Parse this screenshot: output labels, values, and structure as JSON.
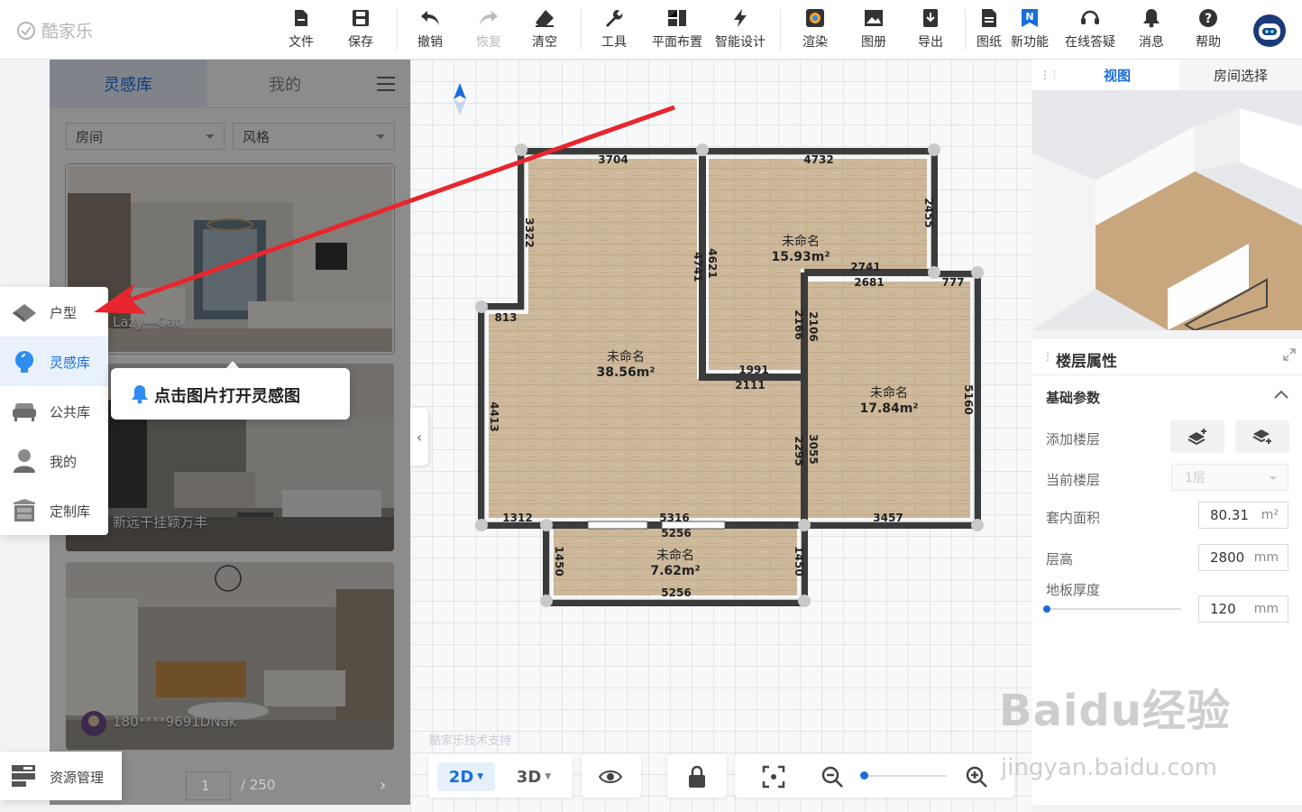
{
  "app": {
    "logo_text": "酷家乐"
  },
  "toolbar": {
    "file": "文件",
    "save": "保存",
    "undo": "撤销",
    "redo": "恢复",
    "clear": "清空",
    "tools": "工具",
    "layout": "平面布置",
    "smart": "智能设计",
    "render": "渲染",
    "album": "图册",
    "export": "导出",
    "drawings": "图纸",
    "new_feature": "新功能",
    "support": "在线答疑",
    "messages": "消息",
    "help": "帮助"
  },
  "catalog": {
    "tabs": [
      "灵感库",
      "我的"
    ],
    "filters": [
      "房间",
      "风格"
    ],
    "cards": [
      {
        "author": "Lazy—Cat"
      },
      {
        "author": "新远干挂颖万丰"
      },
      {
        "author": "180****9691DNak"
      }
    ],
    "pager": {
      "current": "1",
      "total": "/ 250"
    }
  },
  "leftnav": {
    "items": [
      "户型",
      "灵感库",
      "公共库",
      "我的",
      "定制库"
    ],
    "resource": "资源管理"
  },
  "tooltip": {
    "text": "点击图片打开灵感图"
  },
  "floorplan": {
    "rooms": [
      {
        "name": "未命名",
        "area": "38.56m²"
      },
      {
        "name": "未命名",
        "area": "15.93m²"
      },
      {
        "name": "未命名",
        "area": "17.84m²"
      },
      {
        "name": "未命名",
        "area": "7.62m²"
      }
    ],
    "dims": [
      "3704",
      "4732",
      "3322",
      "2455",
      "4741",
      "4621",
      "2741",
      "2681",
      "777",
      "813",
      "1991",
      "2111",
      "2166",
      "2106",
      "4413",
      "5160",
      "2295",
      "3055",
      "1312",
      "5316",
      "5256",
      "3457",
      "1450",
      "1450",
      "5256"
    ]
  },
  "canvas": {
    "watermark": "酷家乐技术支持"
  },
  "bottombar": {
    "view2d": "2D",
    "view3d": "3D"
  },
  "rightpanel": {
    "tabs": [
      "视图",
      "房间选择"
    ],
    "title": "楼层属性",
    "section": "基础参数",
    "add_floor": "添加楼层",
    "current_floor": "当前楼层",
    "current_floor_value": "1层",
    "inner_area": "套内面积",
    "inner_area_value": "80.31",
    "inner_area_unit": "m²",
    "height": "层高",
    "height_value": "2800",
    "height_unit": "mm",
    "floor_thickness": "地板厚度",
    "floor_thickness_value": "120",
    "floor_thickness_unit": "mm"
  },
  "watermark": {
    "brand": "Baidu经验",
    "url": "jingyan.baidu.com"
  },
  "colors": {
    "accent": "#1a6ddb",
    "arrow": "#e8262d",
    "wall": "#3b3b3b",
    "floor": "#cdb89b"
  }
}
